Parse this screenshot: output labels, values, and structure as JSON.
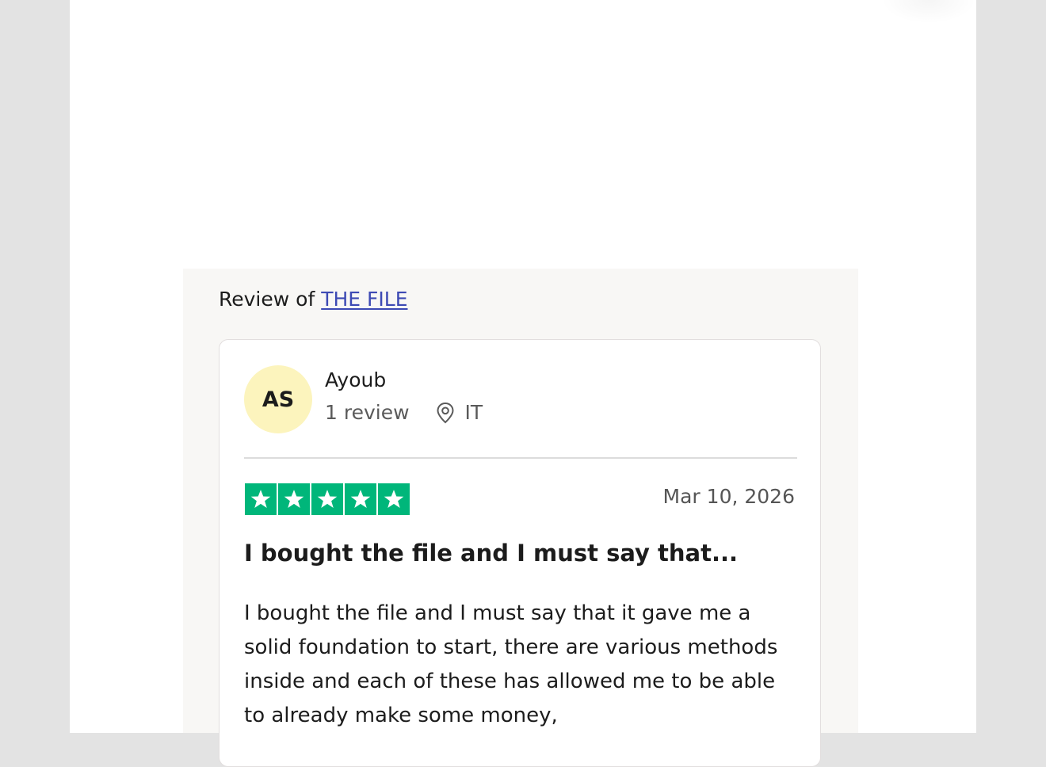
{
  "review_header": {
    "prefix": "Review of",
    "company_link": "THE FILE"
  },
  "reviewer": {
    "initials": "AS",
    "name": "Ayoub",
    "review_count": "1 review",
    "country": "IT"
  },
  "review": {
    "rating": 5,
    "rating_max": 5,
    "date": "Mar 10, 2026",
    "title": "I bought the file and I must say that...",
    "body": "I bought the file and I must say that it gave me a solid foundation to start, there are various methods inside and each of these has allowed me to be able to already make some money,"
  },
  "colors": {
    "star_green": "#00b67a",
    "avatar_bg": "#fcf4bd",
    "link": "#3d4ab4"
  },
  "icons": {
    "location": "location-pin-icon",
    "star": "star-icon"
  }
}
